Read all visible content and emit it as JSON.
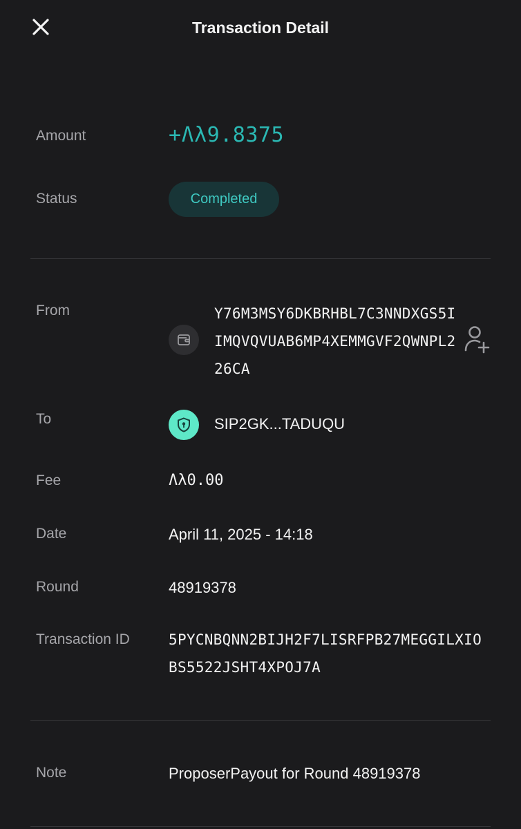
{
  "header": {
    "title": "Transaction Detail",
    "close_icon": "close-icon"
  },
  "amount": {
    "label": "Amount",
    "value": "+ALGO9.8375",
    "display_value": "+Ʌλ9.8375",
    "color": "#2bb8b3"
  },
  "status": {
    "label": "Status",
    "value": "Completed",
    "badge_bg": "#183537",
    "text_color": "#3fc9c2"
  },
  "from": {
    "label": "From",
    "address": "Y76M3MSY6DKBRHBL7C3NNDXGS5IIMQVQVUAB6MP4XEMMGVF2QWNPL226CA",
    "icon": "wallet-icon",
    "action_icon": "add-contact-icon"
  },
  "to": {
    "label": "To",
    "address": "SIP2GK...TADUQU",
    "icon": "shield-lock-icon",
    "icon_bg": "#5ee8c8"
  },
  "fee": {
    "label": "Fee",
    "value": "Ʌλ0.00"
  },
  "date": {
    "label": "Date",
    "value": "April 11, 2025 - 14:18"
  },
  "round": {
    "label": "Round",
    "value": "48919378"
  },
  "transaction_id": {
    "label": "Transaction ID",
    "value": "5PYCNBQNN2BIJH2F7LISRFPB27MEGGILXIOBS5522JSHT4XPOJ7A"
  },
  "note": {
    "label": "Note",
    "value": "ProposerPayout for Round 48919378"
  }
}
